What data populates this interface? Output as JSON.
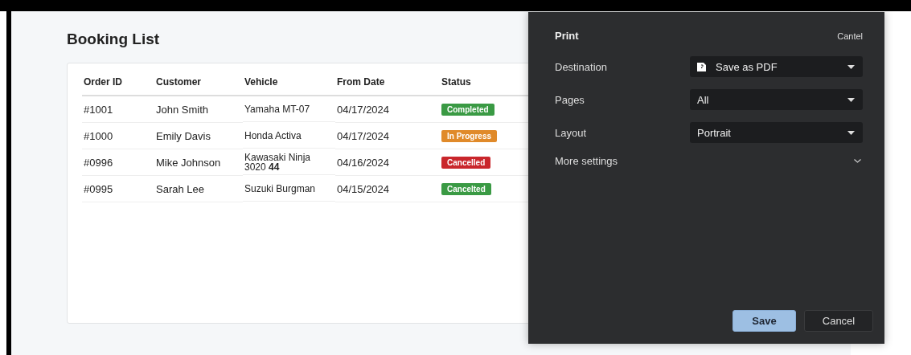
{
  "page": {
    "title": "Booking List"
  },
  "table": {
    "columns": [
      "Order ID",
      "Customer",
      "Vehicle",
      "From Date",
      "Status"
    ],
    "rows": [
      {
        "order_id": "#1001",
        "customer": "John Smith",
        "vehicle": "Yamaha MT-07",
        "from_date": "04/17/2024",
        "status": "Completed",
        "color": "#3a9a44"
      },
      {
        "order_id": "#1000",
        "customer": "Emily Davis",
        "vehicle": "Honda Activa",
        "from_date": "04/17/2024",
        "status": "In Progress",
        "color": "#e08a2a"
      },
      {
        "order_id": "#0996",
        "customer": "Mike Johnson",
        "vehicle": "Kawasaki Ninja 3020 **44**",
        "from_date": "04/16/2024",
        "status": "Cancelled",
        "color": "#c9262b"
      },
      {
        "order_id": "#0995",
        "customer": "Sarah Lee",
        "vehicle": "Suzuki Burgman",
        "from_date": "04/15/2024",
        "status": "Cancelted",
        "color": "#3a9a44"
      }
    ]
  },
  "print_dialog": {
    "title": "Print",
    "close": "Cantel",
    "settings": [
      {
        "label": "Destination",
        "value": "Save as PDF",
        "kind": "file"
      },
      {
        "label": "Pages",
        "value": "All",
        "kind": "plain"
      },
      {
        "label": "Layout",
        "value": "Portrait",
        "kind": "plain"
      }
    ],
    "more_settings": "More settings",
    "buttons": [
      {
        "label": "Save",
        "kind": "primary"
      },
      {
        "label": "Cancel",
        "kind": "secondary"
      }
    ]
  }
}
